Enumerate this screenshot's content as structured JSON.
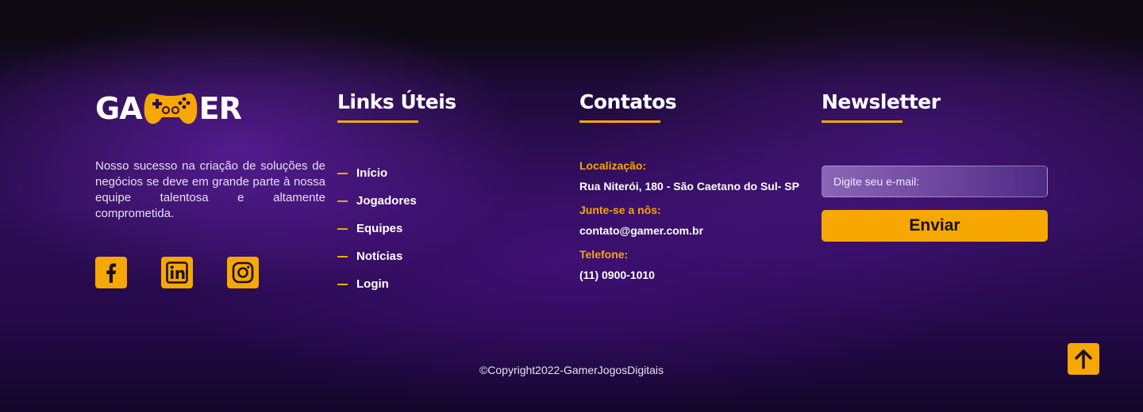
{
  "brand": {
    "logo_left": "GA",
    "logo_right": "ER"
  },
  "about": {
    "text": "Nosso sucesso na criação de soluções de negócios se deve em grande parte à nossa equipe talentosa e altamente comprometida."
  },
  "social": [
    {
      "icon": "facebook-icon"
    },
    {
      "icon": "linkedin-icon"
    },
    {
      "icon": "instagram-icon"
    }
  ],
  "links": {
    "title": "Links Úteis",
    "items": [
      "Início",
      "Jogadores",
      "Equipes",
      "Notícias",
      "Login"
    ]
  },
  "contacts": {
    "title": "Contatos",
    "location_label": "Localização:",
    "location_value": "Rua Niterói, 180 - São Caetano do Sul- SP",
    "join_label": "Junte-se a nôs:",
    "email_value": "contato@gamer.com.br",
    "phone_label": "Telefone:",
    "phone_value": "(11) 0900-1010"
  },
  "newsletter": {
    "title": "Newsletter",
    "placeholder": "Digite seu e-mail:",
    "button_label": "Enviar"
  },
  "footer": {
    "copyright": "©Copyright2022-GamerJogosDigitais"
  },
  "colors": {
    "accent": "#f6a800",
    "background": "#2a0d52"
  }
}
